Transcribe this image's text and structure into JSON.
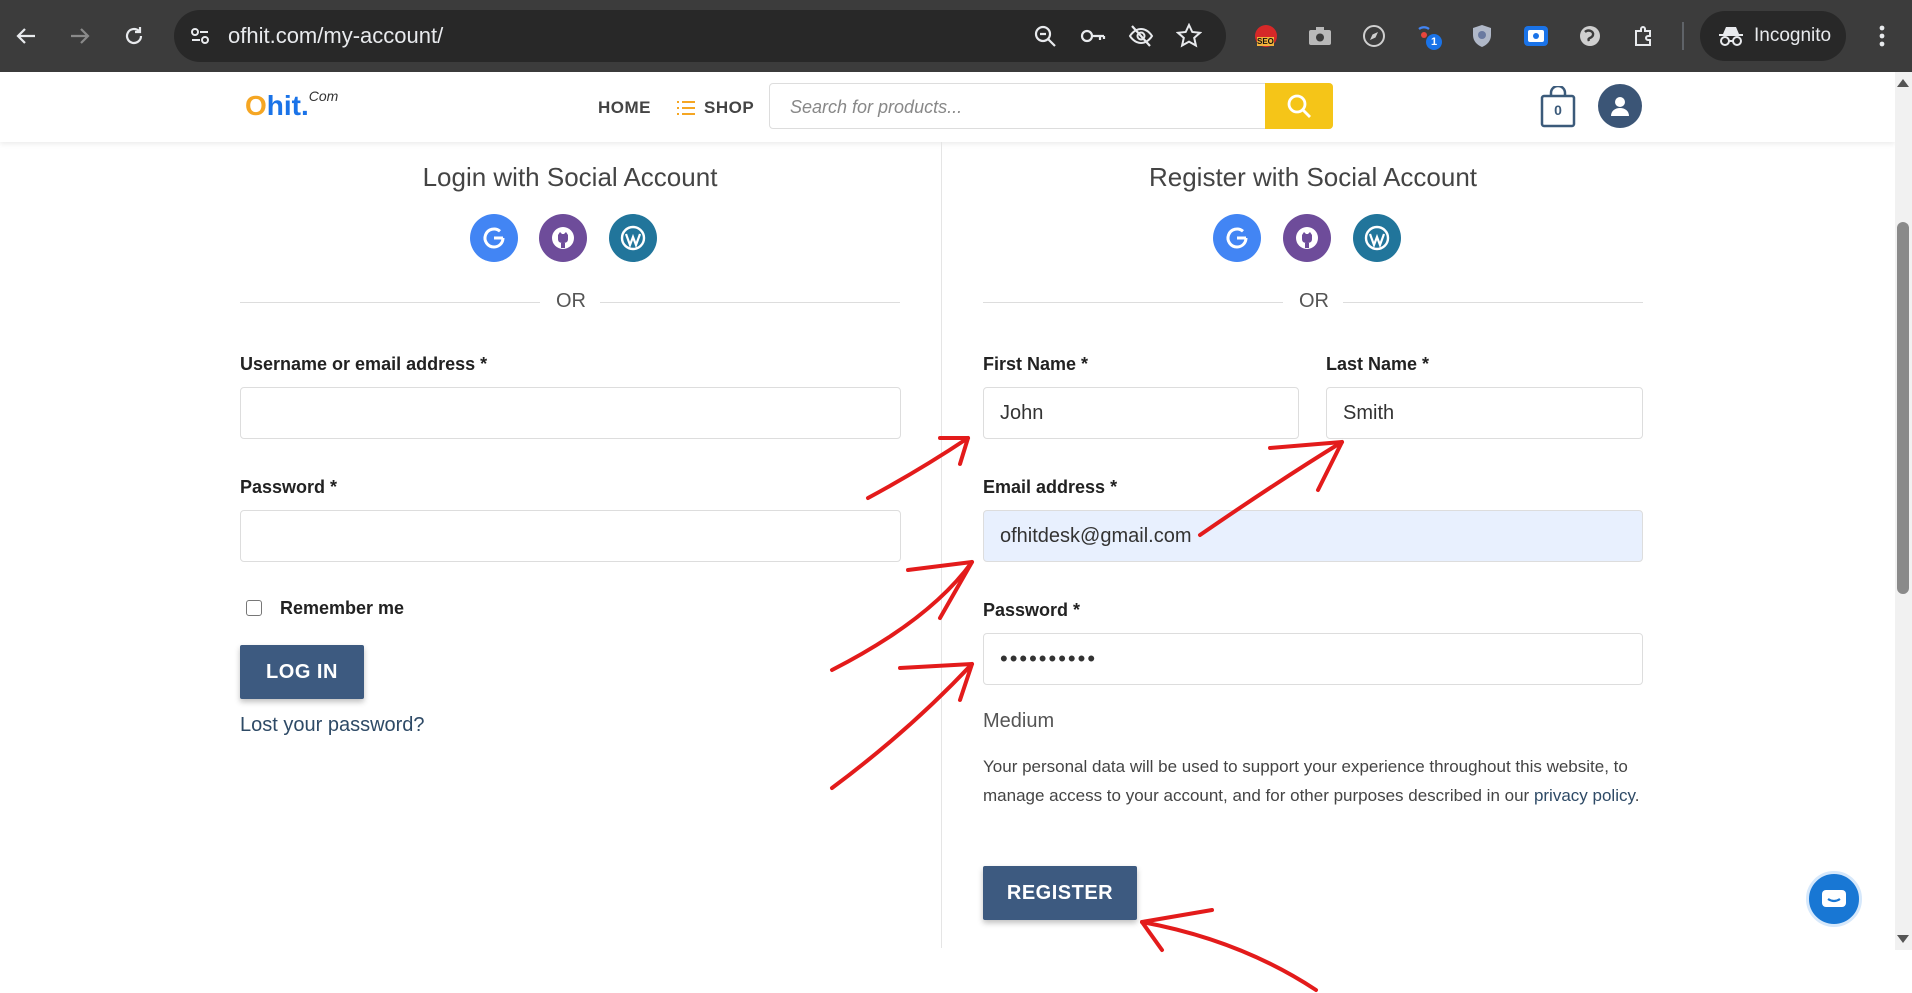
{
  "browser": {
    "url": "ofhit.com/my-account/",
    "mode_label": "Incognito",
    "extension_badge": "1",
    "extension_seo_label": "SEO"
  },
  "header": {
    "logo": {
      "main": "hit.",
      "first_letter": "O",
      "suffix": "Com"
    },
    "nav": {
      "home": "HOME",
      "shop": "SHOP"
    },
    "search_placeholder": "Search for products...",
    "cart_count": "0"
  },
  "login": {
    "title": "Login with Social Account",
    "or_label": "OR",
    "username_label": "Username or email address *",
    "username_value": "",
    "password_label": "Password *",
    "password_value": "",
    "remember_label": "Remember me",
    "login_button": "LOG IN",
    "lost_password": "Lost your password?"
  },
  "register": {
    "title": "Register with Social Account",
    "or_label": "OR",
    "first_name_label": "First Name *",
    "first_name_value": "John",
    "last_name_label": "Last Name *",
    "last_name_value": "Smith",
    "email_label": "Email address *",
    "email_value": "ofhitdesk@gmail.com",
    "password_label": "Password *",
    "password_value": "••••••••••",
    "strength": "Medium",
    "privacy_text": "Your personal data will be used to support your experience throughout this website, to manage access to your account, and for other purposes described in our ",
    "privacy_link": "privacy policy",
    "privacy_end": ".",
    "register_button": "REGISTER"
  },
  "social_icons": [
    "google-icon",
    "github-icon",
    "wordpress-icon"
  ],
  "colors": {
    "primary_button": "#3d5a80",
    "search_accent": "#f5c518",
    "annotation_arrows": "#e31b1b"
  }
}
